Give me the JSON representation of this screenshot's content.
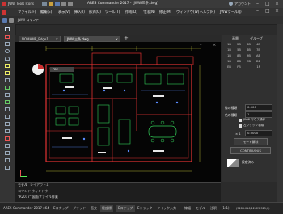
{
  "app": {
    "title": "ARES Commander 2017 - [JWW三条.dwg]",
    "toolbar_name": "JWW Tools Icons",
    "account": "アカウント"
  },
  "menu": {
    "items": [
      "ファイル(F)",
      "編集(E)",
      "表示(V)",
      "挿入(I)",
      "形式(O)",
      "ツール(T)",
      "作成(D)",
      "寸法(N)",
      "修正(M)",
      "ウィンドウ(W)",
      "ヘルプ(H)",
      "JWWツール(J)"
    ]
  },
  "command_label": "JWW コマンド",
  "tabs": {
    "items": [
      "NOMAME_Edge1",
      "JWW三条.dwg"
    ],
    "add": "+"
  },
  "canvas": {
    "badge": "PDE"
  },
  "layout_tabs": [
    "モデル",
    "レイアウト1"
  ],
  "command_window": {
    "title": "コマンド ウィンドウ",
    "history": "\"R2017\" 図面ファイル作業"
  },
  "right_panel": {
    "header_layer": "画層",
    "header_group": "グループ",
    "grid": [
      [
        "1B",
        "2B",
        "3B",
        "4B"
      ],
      [
        "1B",
        "5B",
        "6B",
        "7B"
      ],
      [
        "1B",
        "8B",
        "9B",
        "AB"
      ],
      [
        "1B",
        "BB",
        "CB",
        "DB"
      ],
      [
        "EB",
        "FB",
        "",
        "1F"
      ]
    ],
    "prop_linetype": "線の種類",
    "prop_linetype_value": "0.000",
    "prop_color": "色の種類",
    "prop_color_value": "1",
    "check1": "JWW マウス操作",
    "check2": "左クリック手順",
    "prop_scale": "× 1",
    "prop_scale_value": "0.0000",
    "btn_mode": "モード解除",
    "btn_continuous": "CONTINUOUS",
    "layer_name": "設定済み"
  },
  "status": {
    "app_version": "ARES Commander 2017 x64",
    "snap": "Eスナップ",
    "grid": "グリッド",
    "ortho": "直交",
    "polar": "極座標",
    "esnap": "Eスナップ",
    "etrack": "Eトラック",
    "quick": "クイック入力",
    "lineweight": "線幅",
    "model": "モデル",
    "annotation": "注釈",
    "scale": "(1:1)",
    "coords": "(5286.016,12425.525,0)"
  },
  "colors": {
    "background": "#050505",
    "wall": "#e23232",
    "fixture": "#33d05a",
    "dimension": "#e0e040",
    "annotation": "#5a8cff",
    "text": "#e8e8e8"
  }
}
